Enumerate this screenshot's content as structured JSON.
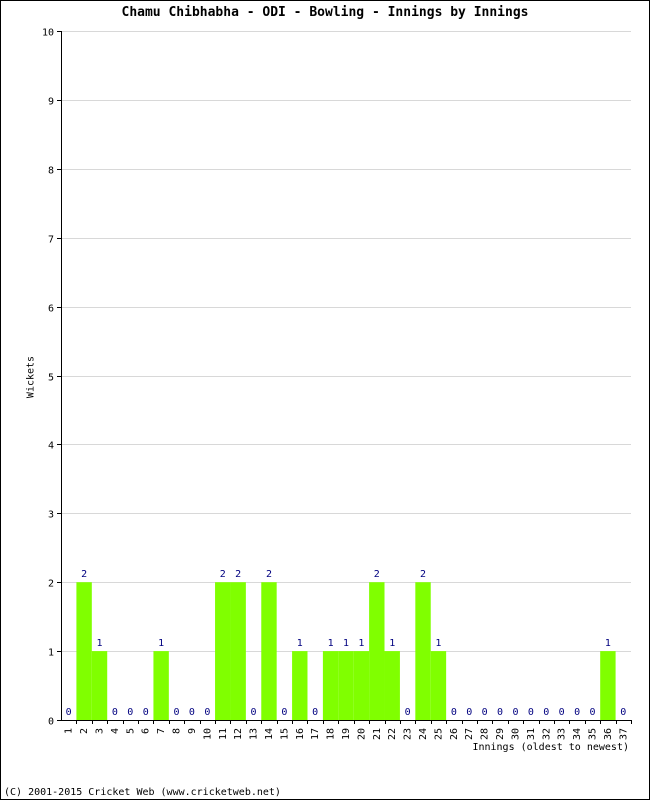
{
  "chart_data": {
    "type": "bar",
    "title": "Chamu Chibhabha - ODI - Bowling - Innings by Innings",
    "xlabel": "Innings (oldest to newest)",
    "ylabel": "Wickets",
    "ylim": [
      0,
      10
    ],
    "yticks": [
      0,
      1,
      2,
      3,
      4,
      5,
      6,
      7,
      8,
      9,
      10
    ],
    "grid": true,
    "categories": [
      "1",
      "2",
      "3",
      "4",
      "5",
      "6",
      "7",
      "8",
      "9",
      "10",
      "11",
      "12",
      "13",
      "14",
      "15",
      "16",
      "17",
      "18",
      "19",
      "20",
      "21",
      "22",
      "23",
      "24",
      "25",
      "26",
      "27",
      "28",
      "29",
      "30",
      "31",
      "32",
      "33",
      "34",
      "35",
      "36",
      "37"
    ],
    "values": [
      0,
      2,
      1,
      0,
      0,
      0,
      1,
      0,
      0,
      0,
      2,
      2,
      0,
      2,
      0,
      1,
      0,
      1,
      1,
      1,
      2,
      1,
      0,
      2,
      1,
      0,
      0,
      0,
      0,
      0,
      0,
      0,
      0,
      0,
      0,
      1,
      0
    ],
    "bar_color": "#80ff00",
    "label_color": "#000080",
    "grid_color": "#d8d8d8"
  },
  "footer": "(C) 2001-2015 Cricket Web (www.cricketweb.net)"
}
